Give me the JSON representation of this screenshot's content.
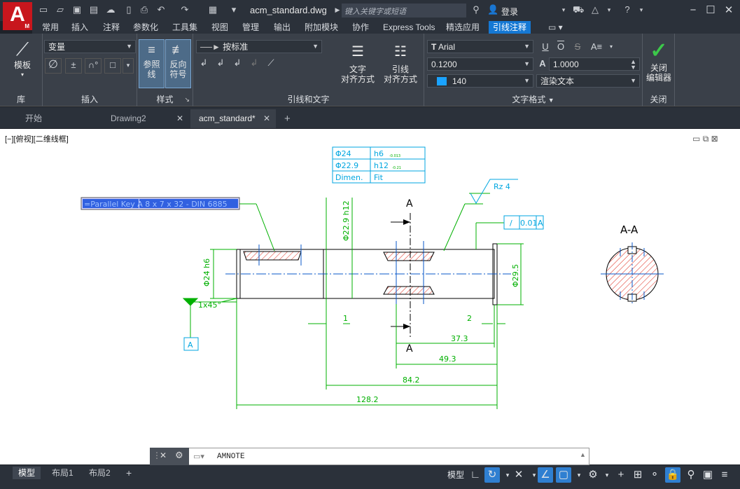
{
  "titlebar": {
    "logo_letter": "A",
    "logo_sub": "M",
    "filename": "acm_standard.dwg",
    "search_placeholder": "键入关键字或短语",
    "login_label": "登录"
  },
  "ribbon_tabs": [
    "常用",
    "插入",
    "注释",
    "参数化",
    "工具集",
    "视图",
    "管理",
    "输出",
    "附加模块",
    "协作",
    "Express Tools",
    "精选应用",
    "引线注释"
  ],
  "active_tab": "引线注释",
  "ribbon": {
    "library": {
      "button_label": "模板",
      "title": "库"
    },
    "insert": {
      "variable_dropdown": "变量",
      "title": "插入",
      "pm_symbol": "±"
    },
    "style": {
      "ref_line_label_1": "参照",
      "ref_line_label_2": "线",
      "reverse_label_1": "反向",
      "reverse_label_2": "符号",
      "title": "样式"
    },
    "leader_text": {
      "leader_dropdown": "按标准",
      "text_align_label_1": "文字",
      "text_align_label_2": "对齐方式",
      "leader_align_label_1": "引线",
      "leader_align_label_2": "对齐方式",
      "title": "引线和文字"
    },
    "text_format": {
      "font": "Arial",
      "height": "0.1200",
      "color_value": "140",
      "color_swatch": "#1aa3ff",
      "width_factor": "1.0000",
      "render_mode": "渲染文本",
      "title": "文字格式",
      "underline": "U",
      "overline": "O",
      "strike": "S",
      "case": "A≡"
    },
    "close": {
      "label_1": "关闭",
      "label_2": "编辑器",
      "title": "关闭"
    }
  },
  "doc_tabs": [
    {
      "label": "开始",
      "closable": false,
      "active": false
    },
    {
      "label": "Drawing2",
      "closable": true,
      "active": false
    },
    {
      "label": "acm_standard*",
      "closable": true,
      "active": true
    }
  ],
  "viewport_label": "[−][俯视][二维线框]",
  "drawing": {
    "fit_table": {
      "rows": [
        [
          "Φ24",
          "h6"
        ],
        [
          "Φ22.9",
          "h12"
        ],
        [
          "Dimen.",
          "Fit"
        ]
      ],
      "tol_1": "-0.013",
      "tol_2": "-0.21"
    },
    "key_note": "=Parallel Key  A 8 x 7 x 32 - DIN 6885",
    "roughness": "Rz 4",
    "section_mark": "A",
    "section_title": "A-A",
    "chamfer": "1x45°",
    "datum": "A",
    "geo_tol": {
      "symbol": "/",
      "value": "0.01",
      "datum": "A"
    },
    "dims": {
      "dia_24": "Φ24 h6",
      "dia_229": "Φ22.9 h12",
      "dia_295": "Φ29.5",
      "d1": "1",
      "d2": "2",
      "d373": "37.3",
      "d493": "49.3",
      "d842": "84.2",
      "d1282": "128.2"
    }
  },
  "command": {
    "text": "AMNOTE"
  },
  "layout_tabs": [
    {
      "label": "模型",
      "active": true
    },
    {
      "label": "布局1",
      "active": false
    },
    {
      "label": "布局2",
      "active": false
    }
  ],
  "status": {
    "model_label": "模型"
  },
  "colors": {
    "accent": "#1578d4",
    "drawing_green": "#00b000",
    "drawing_cyan": "#00a6e0",
    "hatch_red": "#e03020"
  }
}
